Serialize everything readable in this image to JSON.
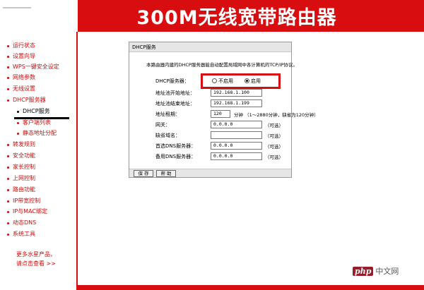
{
  "header": {
    "title": "300M无线宽带路由器"
  },
  "sidebar": {
    "items": [
      {
        "label": "运行状态"
      },
      {
        "label": "设置向导"
      },
      {
        "label": "WPS一键安全设定"
      },
      {
        "label": "网络参数"
      },
      {
        "label": "无线设置"
      },
      {
        "label": "DHCP服务器"
      },
      {
        "label": "DHCP服务"
      },
      {
        "label": "客户端列表"
      },
      {
        "label": "静态地址分配"
      },
      {
        "label": "转发规则"
      },
      {
        "label": "安全功能"
      },
      {
        "label": "家长控制"
      },
      {
        "label": "上网控制"
      },
      {
        "label": "路由功能"
      },
      {
        "label": "IP带宽控制"
      },
      {
        "label": "IP与MAC绑定"
      },
      {
        "label": "动态DNS"
      },
      {
        "label": "系统工具"
      }
    ],
    "more_line1": "更多水星产品，",
    "more_line2": "请点击查看 >>"
  },
  "panel": {
    "title": "DHCP服务",
    "description": "本路由器内建的DHCP服务器能自动配置局域网中各计算机的TCP/IP协议。",
    "dhcp_server_label": "DHCP服务器：",
    "option_disable": "不启用",
    "option_enable": "启用",
    "selected": "启用",
    "start_ip_label": "地址池开始地址：",
    "start_ip_value": "192.168.1.100",
    "end_ip_label": "地址池结束地址：",
    "end_ip_value": "192.168.1.199",
    "lease_label": "地址租期：",
    "lease_value": "120",
    "lease_note": "分钟 （1～2880分钟，缺省为120分钟）",
    "gateway_label": "网关：",
    "gateway_value": "0.0.0.0",
    "optional": "（可选）",
    "domain_label": "缺省域名：",
    "domain_value": "",
    "primary_dns_label": "首选DNS服务器：",
    "primary_dns_value": "0.0.0.0",
    "secondary_dns_label": "备用DNS服务器：",
    "secondary_dns_value": "0.0.0.0",
    "save_button": "保 存",
    "help_button": "帮 助"
  },
  "watermark": {
    "logo": "php",
    "text": "中文网"
  },
  "colors": {
    "brand_red": "#d80d0f",
    "panel_header": "#e6e6e6"
  }
}
